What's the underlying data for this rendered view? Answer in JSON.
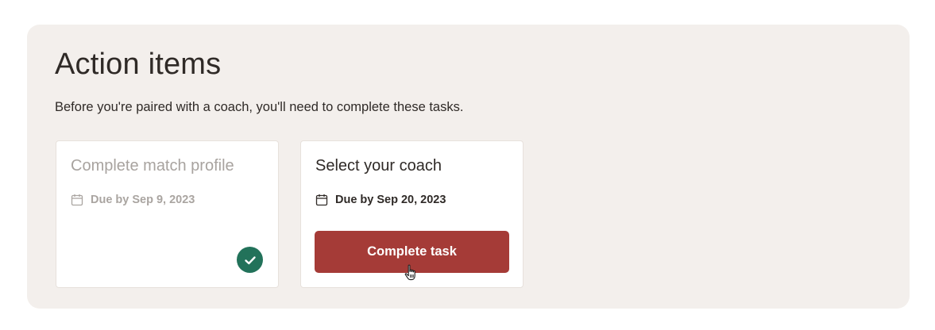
{
  "action_items": {
    "title": "Action items",
    "subtitle": "Before you're paired with a coach, you'll need to complete these tasks.",
    "tasks": [
      {
        "title": "Complete match profile",
        "due": "Due by Sep 9, 2023",
        "status": "completed",
        "icon": "calendar-icon",
        "status_icon": "check-circle-icon"
      },
      {
        "title": "Select your coach",
        "due": "Due by Sep 20, 2023",
        "status": "pending",
        "icon": "calendar-icon",
        "button_label": "Complete task"
      }
    ]
  },
  "colors": {
    "panel_bg": "#f3efec",
    "primary_button": "#a53b37",
    "success": "#22725a",
    "muted_text": "#a8a39f"
  }
}
